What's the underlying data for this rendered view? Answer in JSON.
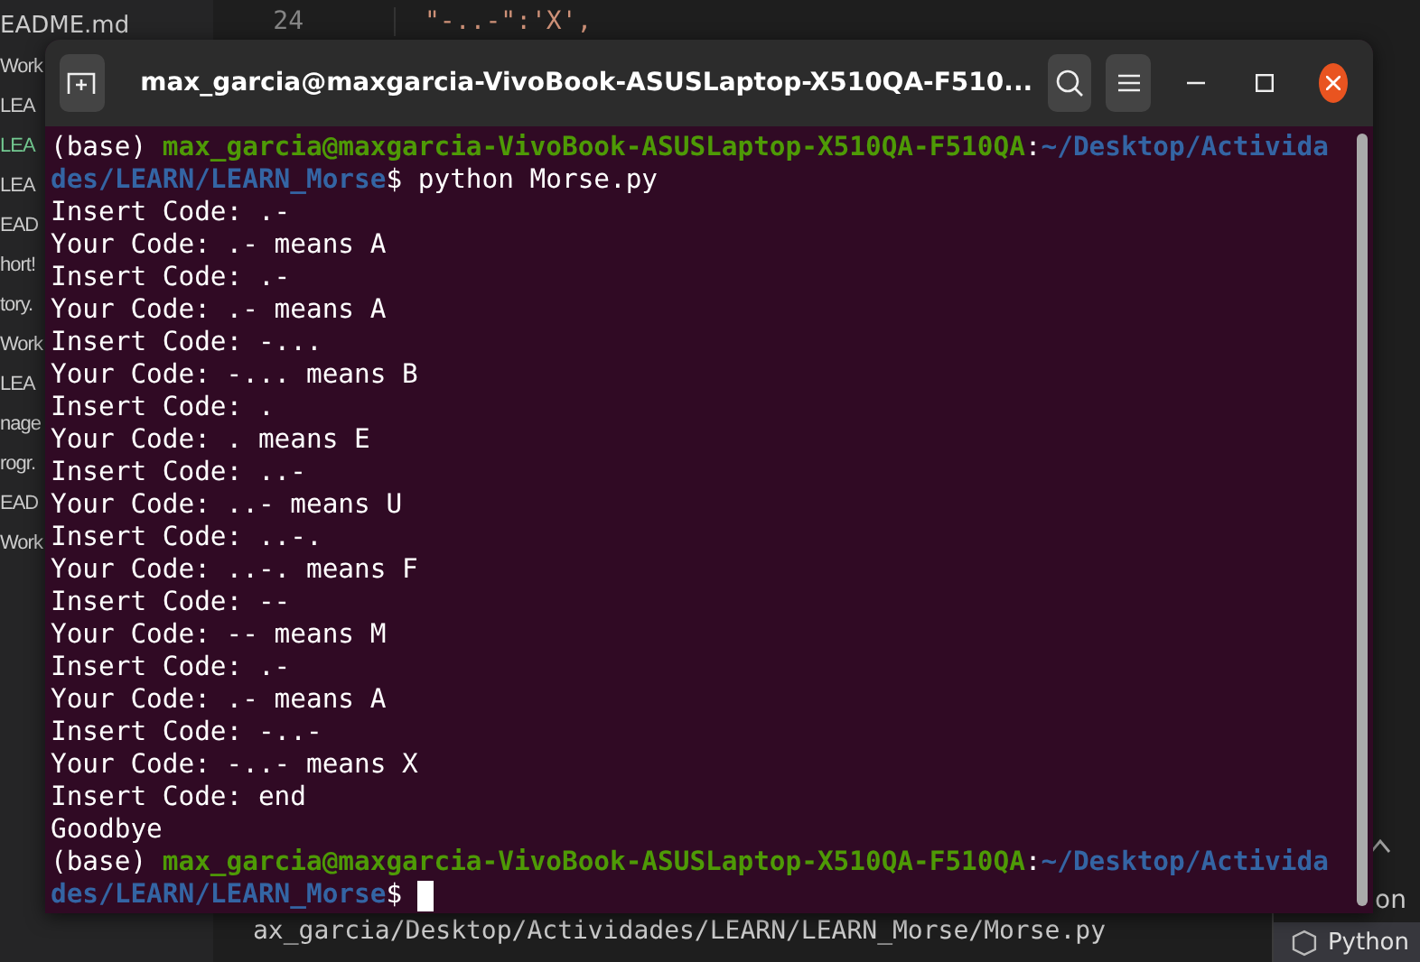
{
  "background_editor": {
    "explorer_items": [
      {
        "label": "EADME.md",
        "selected": false
      },
      {
        "label": "Work",
        "selected": false
      },
      {
        "label": "LEA",
        "selected": false
      },
      {
        "label": "LEA",
        "selected": true
      },
      {
        "label": "LEA",
        "selected": false
      },
      {
        "label": "EAD",
        "selected": false
      },
      {
        "label": "hort!",
        "selected": false
      },
      {
        "label": "tory.",
        "selected": false
      },
      {
        "label": "Work",
        "selected": false
      },
      {
        "label": "LEA",
        "selected": false
      },
      {
        "label": "nage",
        "selected": false
      },
      {
        "label": "rogr.",
        "selected": false
      },
      {
        "label": "EAD",
        "selected": false
      },
      {
        "label": "Work",
        "selected": false
      }
    ],
    "line_number": "24",
    "code_line": "\"-..-\":'X',",
    "panel_lines": [
      "ax_garcia/Desktop/Actividades/LEARN/LEARN_Morse/Morse.py"
    ],
    "side_panel_text": "on",
    "terminal_tab": "Python"
  },
  "window": {
    "title": "max_garcia@maxgarcia-VivoBook-ASUSLaptop-X510QA-F510..."
  },
  "terminal": {
    "cursor": true,
    "lines": [
      [
        {
          "kind": "plain",
          "text": "(base) "
        },
        {
          "kind": "user",
          "text": "max_garcia@maxgarcia-VivoBook-ASUSLaptop-X510QA-F510QA"
        },
        {
          "kind": "plain",
          "text": ":"
        },
        {
          "kind": "path",
          "text": "~/Desktop/Activida"
        }
      ],
      [
        {
          "kind": "path",
          "text": "des/LEARN/LEARN_Morse"
        },
        {
          "kind": "plain",
          "text": "$ python Morse.py"
        }
      ],
      [
        {
          "kind": "plain",
          "text": "Insert Code: .-"
        }
      ],
      [
        {
          "kind": "plain",
          "text": "Your Code: .- means A"
        }
      ],
      [
        {
          "kind": "plain",
          "text": "Insert Code: .-"
        }
      ],
      [
        {
          "kind": "plain",
          "text": "Your Code: .- means A"
        }
      ],
      [
        {
          "kind": "plain",
          "text": "Insert Code: -..."
        }
      ],
      [
        {
          "kind": "plain",
          "text": "Your Code: -... means B"
        }
      ],
      [
        {
          "kind": "plain",
          "text": "Insert Code: ."
        }
      ],
      [
        {
          "kind": "plain",
          "text": "Your Code: . means E"
        }
      ],
      [
        {
          "kind": "plain",
          "text": "Insert Code: ..-"
        }
      ],
      [
        {
          "kind": "plain",
          "text": "Your Code: ..- means U"
        }
      ],
      [
        {
          "kind": "plain",
          "text": "Insert Code: ..-."
        }
      ],
      [
        {
          "kind": "plain",
          "text": "Your Code: ..-. means F"
        }
      ],
      [
        {
          "kind": "plain",
          "text": "Insert Code: --"
        }
      ],
      [
        {
          "kind": "plain",
          "text": "Your Code: -- means M"
        }
      ],
      [
        {
          "kind": "plain",
          "text": "Insert Code: .-"
        }
      ],
      [
        {
          "kind": "plain",
          "text": "Your Code: .- means A"
        }
      ],
      [
        {
          "kind": "plain",
          "text": "Insert Code: -..-"
        }
      ],
      [
        {
          "kind": "plain",
          "text": "Your Code: -..- means X"
        }
      ],
      [
        {
          "kind": "plain",
          "text": "Insert Code: end"
        }
      ],
      [
        {
          "kind": "plain",
          "text": "Goodbye"
        }
      ],
      [
        {
          "kind": "plain",
          "text": "(base) "
        },
        {
          "kind": "user",
          "text": "max_garcia@maxgarcia-VivoBook-ASUSLaptop-X510QA-F510QA"
        },
        {
          "kind": "plain",
          "text": ":"
        },
        {
          "kind": "path",
          "text": "~/Desktop/Activida"
        }
      ],
      [
        {
          "kind": "path",
          "text": "des/LEARN/LEARN_Morse"
        },
        {
          "kind": "plain",
          "text": "$ "
        }
      ]
    ]
  }
}
